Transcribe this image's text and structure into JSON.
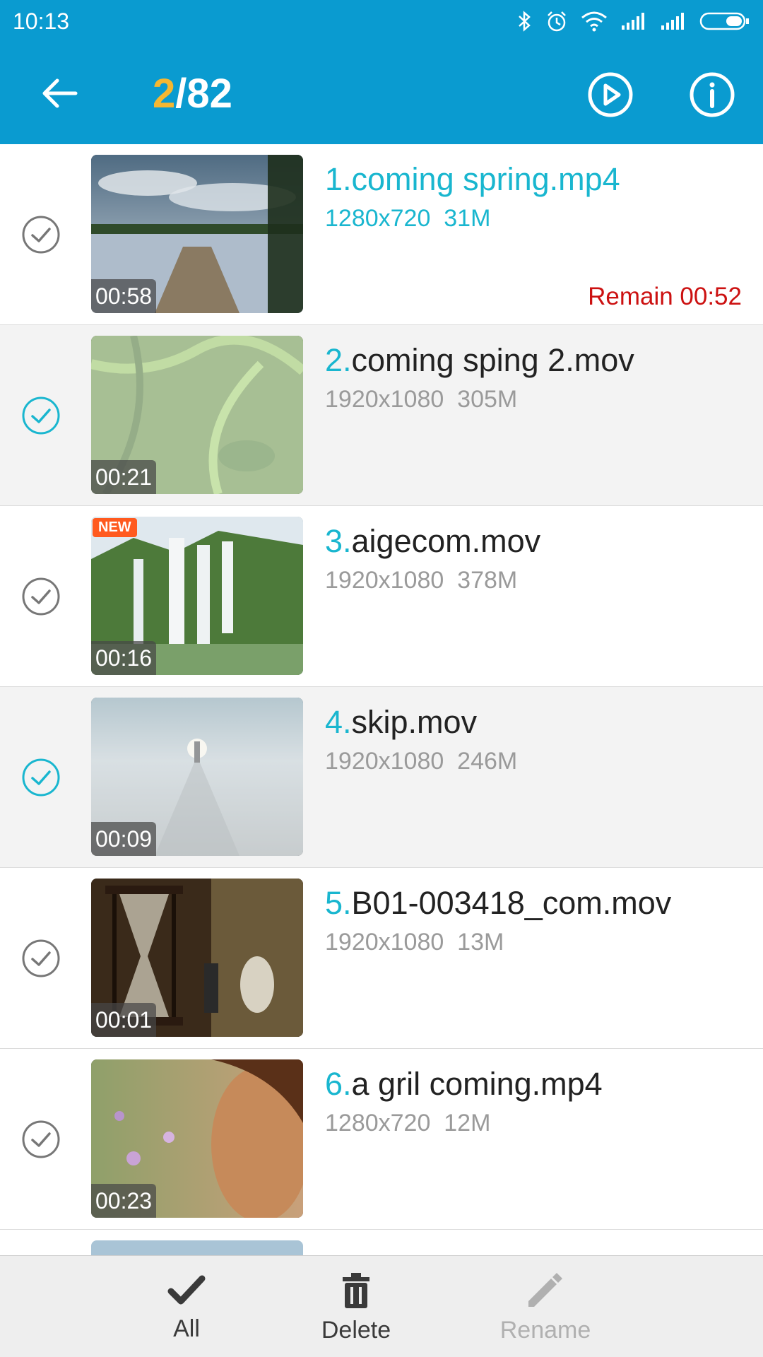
{
  "status_bar": {
    "time": "10:13",
    "icons": [
      "bluetooth-icon",
      "alarm-icon",
      "wifi-icon",
      "signal-icon",
      "signal-icon",
      "battery-icon"
    ]
  },
  "header": {
    "current": "2",
    "separator": "/",
    "total": "82",
    "icons": [
      "back-arrow-icon",
      "play-circle-icon",
      "info-icon"
    ]
  },
  "colors": {
    "bar": "#0a9bd0",
    "accent": "#19b6cf",
    "counter_current": "#f5b731",
    "remain": "#cc1111",
    "new_badge": "#ff5a1f"
  },
  "videos": [
    {
      "num": "1.",
      "name": "coming spring.mp4",
      "meta": "1280x720  31M",
      "duration": "00:58",
      "selected": false,
      "playing": true,
      "remain": "Remain 00:52",
      "new": false
    },
    {
      "num": "2.",
      "name": "coming sping 2.mov",
      "meta": "1920x1080  305M",
      "duration": "00:21",
      "selected": true,
      "playing": false,
      "new": false
    },
    {
      "num": "3.",
      "name": "aigecom.mov",
      "meta": "1920x1080  378M",
      "duration": "00:16",
      "selected": false,
      "playing": false,
      "new": true,
      "badge": "NEW"
    },
    {
      "num": "4.",
      "name": "skip.mov",
      "meta": "1920x1080  246M",
      "duration": "00:09",
      "selected": true,
      "playing": false,
      "new": false
    },
    {
      "num": "5.",
      "name": "B01-003418_com.mov",
      "meta": "1920x1080  13M",
      "duration": "00:01",
      "selected": false,
      "playing": false,
      "new": false
    },
    {
      "num": "6.",
      "name": "a gril coming.mp4",
      "meta": "1280x720  12M",
      "duration": "00:23",
      "selected": false,
      "playing": false,
      "new": false
    }
  ],
  "toolbar": {
    "all_label": "All",
    "delete_label": "Delete",
    "rename_label": "Rename",
    "icons": [
      "checkmark-icon",
      "trash-icon",
      "pencil-icon"
    ]
  }
}
